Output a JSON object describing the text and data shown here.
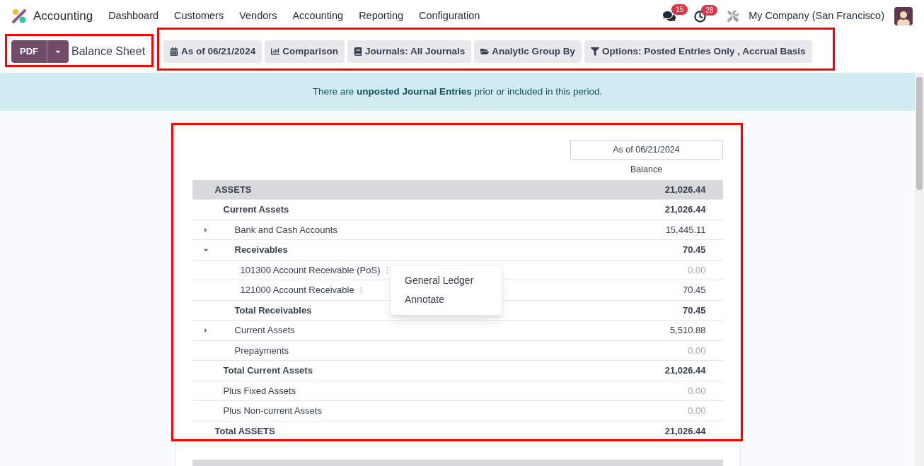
{
  "navbar": {
    "app_name": "Accounting",
    "menu": [
      "Dashboard",
      "Customers",
      "Vendors",
      "Accounting",
      "Reporting",
      "Configuration"
    ],
    "messages_badge": "15",
    "activities_badge": "28",
    "company": "My Company (San Francisco)"
  },
  "control_panel": {
    "pdf_button": "PDF",
    "title": "Balance Sheet",
    "filters": [
      {
        "kind": "date",
        "label": "As of 06/21/2024"
      },
      {
        "kind": "comparison",
        "label": "Comparison"
      },
      {
        "kind": "journals",
        "label": "Journals: All Journals"
      },
      {
        "kind": "analytic",
        "label": "Analytic Group By"
      },
      {
        "kind": "options",
        "label": "Options: Posted Entries Only , Accrual Basis"
      }
    ]
  },
  "alert": {
    "text": "There are **unposted Journal Entries** prior or included in this period."
  },
  "report": {
    "column_header": "As of 06/21/2024",
    "column_label": "Balance",
    "rows": [
      {
        "kind": "section",
        "label": "ASSETS",
        "value": "21,026.44",
        "children": [
          {
            "kind": "group",
            "label": "Current Assets",
            "value": "21,026.44",
            "children": [
              {
                "kind": "line",
                "label": "Bank and Cash Accounts",
                "value": "15,445.11",
                "expanded": false,
                "muted": false
              },
              {
                "kind": "group",
                "label": "Receivables",
                "value": "70.45",
                "expanded": true,
                "children": [
                  {
                    "kind": "account",
                    "label": "101300 Account Receivable (PoS)",
                    "value": "0.00",
                    "muted": true
                  },
                  {
                    "kind": "account",
                    "label": "121000 Account Receivable",
                    "value": "70.45",
                    "muted": false
                  }
                ]
              },
              {
                "kind": "total",
                "label": "Total Receivables",
                "value": "70.45"
              },
              {
                "kind": "line",
                "label": "Current Assets",
                "value": "5,510.88",
                "expanded": false,
                "muted": false
              },
              {
                "kind": "line",
                "label": "Prepayments",
                "value": "0.00",
                "muted": true
              }
            ]
          },
          {
            "kind": "total",
            "label": "Total Current Assets",
            "value": "21,026.44"
          },
          {
            "kind": "line",
            "label": "Plus Fixed Assets",
            "value": "0.00",
            "muted": true
          },
          {
            "kind": "line",
            "label": "Plus Non-current Assets",
            "value": "0.00",
            "muted": true
          }
        ]
      },
      {
        "kind": "total",
        "label": "Total ASSETS",
        "value": "21,026.44"
      }
    ]
  },
  "context_menu": {
    "items": [
      "General Ledger",
      "Annotate"
    ]
  }
}
